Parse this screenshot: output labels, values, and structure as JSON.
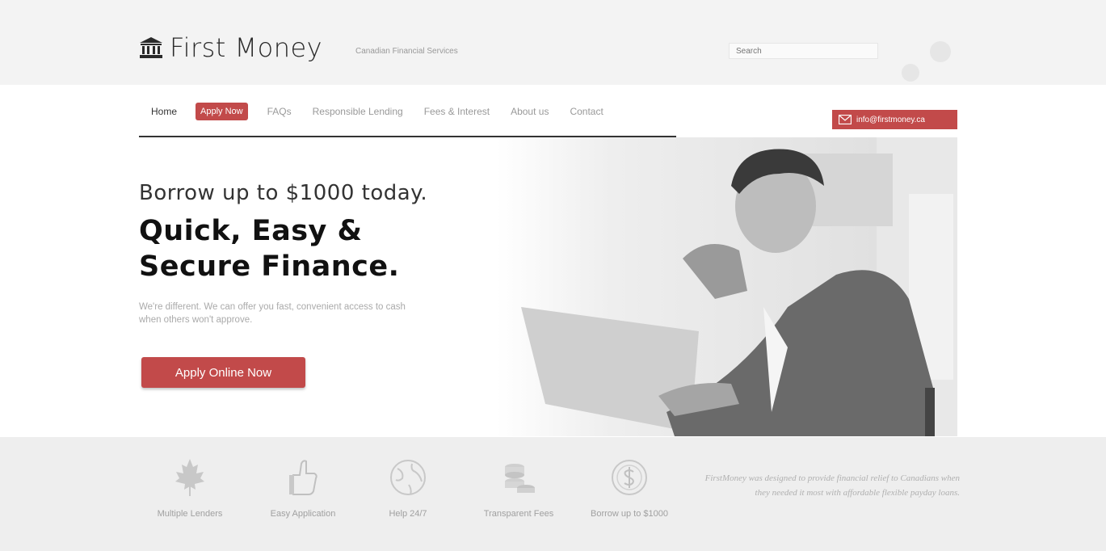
{
  "header": {
    "logo_text": "First Money",
    "tagline": "Canadian Financial Services",
    "search_placeholder": "Search"
  },
  "nav": {
    "items": [
      "Home",
      "Apply Now",
      "FAQs",
      "Responsible Lending",
      "Fees & Interest",
      "About us",
      "Contact"
    ],
    "email": "info@firstmoney.ca"
  },
  "hero": {
    "headline_light": "Borrow up to $1000 today.",
    "headline_bold": "Quick, Easy & Secure Finance.",
    "body": "We're different. We can offer you fast, convenient access to cash when others won't approve.",
    "cta_label": "Apply Online Now"
  },
  "features": [
    {
      "label": "Multiple Lenders",
      "icon": "maple-leaf-icon"
    },
    {
      "label": "Easy Application",
      "icon": "thumbs-up-icon"
    },
    {
      "label": "Help 24/7",
      "icon": "globe-icon"
    },
    {
      "label": "Transparent Fees",
      "icon": "coins-icon"
    },
    {
      "label": "Borrow up to $1000",
      "icon": "dollar-icon"
    }
  ],
  "about_text": "FirstMoney was designed to provide financial relief to Canadians when they needed it most with affordable flexible payday loans.",
  "colors": {
    "accent": "#c24a4a",
    "band": "#eeeeee"
  }
}
